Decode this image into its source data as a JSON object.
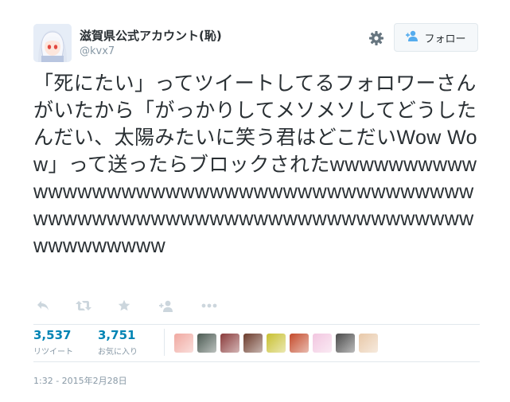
{
  "user": {
    "fullname": "滋賀県公式アカウント(恥)",
    "username": "@kvx7"
  },
  "follow_button": {
    "label": "フォロー"
  },
  "tweet": {
    "text": "「死にたい」ってツイートしてるフォロワーさんがいたから「がっかりしてメソメソしてどうしたんだい、太陽みたいに笑う君はどこだいWow Wow」って送ったらブロックされたwwwwwwwwwwwwwwwwwwwwwwwwwwwwwwwwwwwwwwwwwwwwwwwwwwwwwwwwwwwwwwwwwwwwwwwwwwwwwww"
  },
  "actions": [
    {
      "name": "reply-icon"
    },
    {
      "name": "retweet-icon"
    },
    {
      "name": "favorite-icon"
    },
    {
      "name": "follow-user-icon"
    },
    {
      "name": "more-icon"
    }
  ],
  "stats": {
    "retweets": {
      "count": "3,537",
      "label": "リツイート"
    },
    "favorites": {
      "count": "3,751",
      "label": "お気に入り"
    }
  },
  "favorer_avatars": [
    {
      "color": "#f0a8a0"
    },
    {
      "color": "#4b5a52"
    },
    {
      "color": "#8a3a3a"
    },
    {
      "color": "#6b3a2a"
    },
    {
      "color": "#c8c030"
    },
    {
      "color": "#c44a2a"
    },
    {
      "color": "#f2c6e0"
    },
    {
      "color": "#4a4a4a"
    },
    {
      "color": "#e8c8a8"
    }
  ],
  "timestamp": "1:32 - 2015年2月28日"
}
